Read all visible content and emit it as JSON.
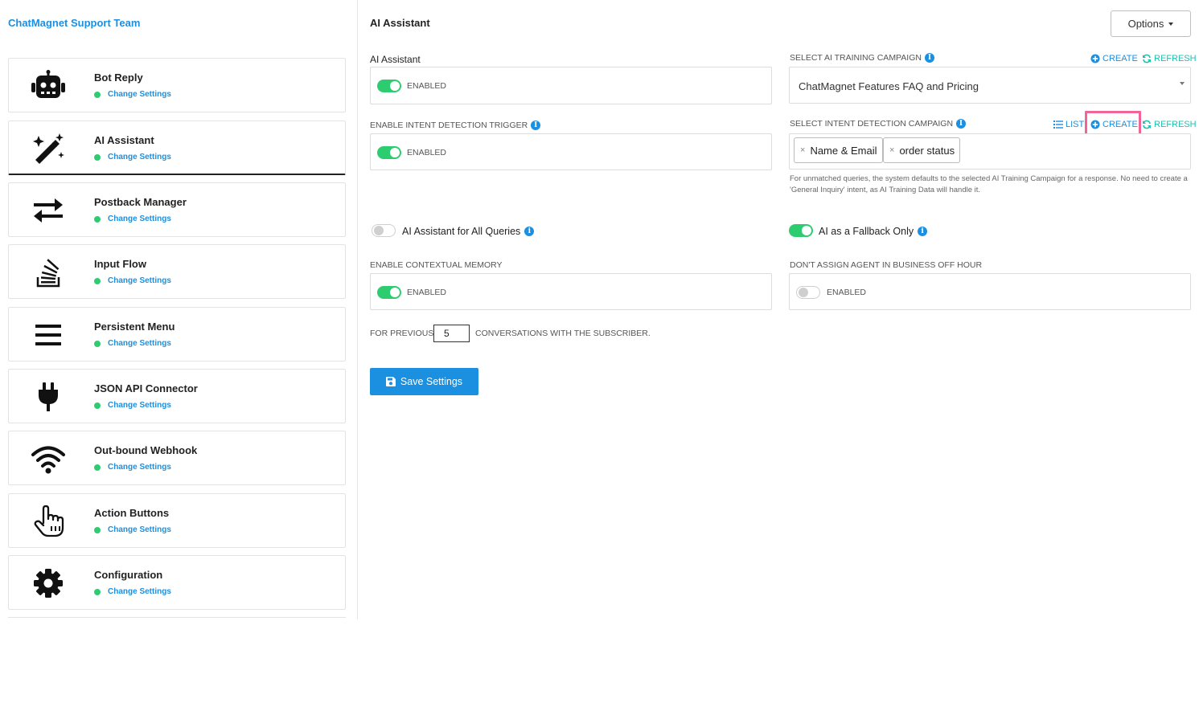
{
  "sidebar": {
    "team_name": "ChatMagnet Support Team",
    "items": [
      {
        "title": "Bot Reply",
        "sub": "Change Settings",
        "icon": "robot-icon"
      },
      {
        "title": "AI Assistant",
        "sub": "Change Settings",
        "icon": "magic-wand-icon"
      },
      {
        "title": "Postback Manager",
        "sub": "Change Settings",
        "icon": "arrows-exchange-icon"
      },
      {
        "title": "Input Flow",
        "sub": "Change Settings",
        "icon": "stack-icon"
      },
      {
        "title": "Persistent Menu",
        "sub": "Change Settings",
        "icon": "hamburger-menu-icon"
      },
      {
        "title": "JSON API Connector",
        "sub": "Change Settings",
        "icon": "plug-icon"
      },
      {
        "title": "Out-bound Webhook",
        "sub": "Change Settings",
        "icon": "wifi-icon"
      },
      {
        "title": "Action Buttons",
        "sub": "Change Settings",
        "icon": "pointer-hand-icon"
      },
      {
        "title": "Configuration",
        "sub": "Change Settings",
        "icon": "gear-icon"
      }
    ]
  },
  "main": {
    "title": "AI Assistant",
    "options_label": "Options",
    "ai_assistant": {
      "label": "AI Assistant",
      "toggle_state": "on",
      "toggle_text": "ENABLED"
    },
    "intent_trigger": {
      "label": "ENABLE INTENT DETECTION TRIGGER",
      "toggle_state": "on",
      "toggle_text": "ENABLED"
    },
    "training_campaign": {
      "label": "SELECT AI TRAINING CAMPAIGN",
      "create": "CREATE",
      "refresh": "REFRESH",
      "selected": "ChatMagnet Features FAQ and Pricing"
    },
    "intent_campaign": {
      "label": "SELECT INTENT DETECTION CAMPAIGN",
      "list": "LIST",
      "create": "CREATE",
      "refresh": "REFRESH",
      "tags": [
        "Name & Email",
        "order status"
      ],
      "help": "For unmatched queries, the system defaults to the selected AI Training Campaign for a response. No need to create a 'General Inquiry' intent, as AI Training Data will handle it."
    },
    "all_queries": {
      "label": "AI Assistant for All Queries",
      "toggle_state": "off"
    },
    "fallback_only": {
      "label": "AI as a Fallback Only",
      "toggle_state": "on"
    },
    "contextual_memory": {
      "label": "ENABLE CONTEXTUAL MEMORY",
      "toggle_state": "on",
      "toggle_text": "ENABLED"
    },
    "business_off_hour": {
      "label": "DON'T ASSIGN AGENT IN BUSINESS OFF HOUR",
      "toggle_state": "off",
      "toggle_text": "ENABLED"
    },
    "previous": {
      "prefix": "FOR PREVIOUS",
      "value": "5",
      "suffix": "CONVERSATIONS WITH THE SUBSCRIBER."
    },
    "save_label": "Save Settings"
  },
  "colors": {
    "accent": "#1b8fe0",
    "toggle_on": "#2ecc71",
    "refresh": "#1ec0b0",
    "highlight": "#f0649a"
  }
}
